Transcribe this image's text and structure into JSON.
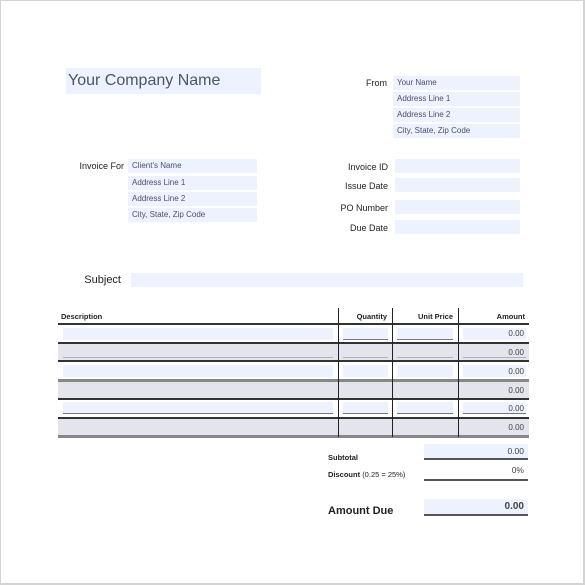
{
  "header": {
    "company_name": "Your Company Name",
    "from_label": "From",
    "from": [
      "Your Name",
      "Address Line 1",
      "Address Line 2",
      "City, State, Zip Code"
    ]
  },
  "invoice_for": {
    "label": "Invoice For",
    "lines": [
      "Client's Name",
      "Address Line 1",
      "Address Line 2",
      "City, State, Zip Code"
    ]
  },
  "meta": {
    "fields": [
      {
        "label": "Invoice ID",
        "value": ""
      },
      {
        "label": "Issue Date",
        "value": ""
      },
      {
        "label": "PO Number",
        "value": ""
      },
      {
        "label": "Due Date",
        "value": ""
      }
    ]
  },
  "subject": {
    "label": "Subject",
    "value": ""
  },
  "table": {
    "headers": {
      "description": "Description",
      "quantity": "Quantity",
      "unit_price": "Unit Price",
      "amount": "Amount"
    },
    "rows": [
      {
        "description": "",
        "quantity": "",
        "unit_price": "",
        "amount": "0.00"
      },
      {
        "description": "",
        "quantity": "",
        "unit_price": "",
        "amount": "0.00"
      },
      {
        "description": "",
        "quantity": "",
        "unit_price": "",
        "amount": "0.00"
      },
      {
        "description": "",
        "quantity": "",
        "unit_price": "",
        "amount": "0.00"
      },
      {
        "description": "",
        "quantity": "",
        "unit_price": "",
        "amount": "0.00"
      },
      {
        "description": "",
        "quantity": "",
        "unit_price": "",
        "amount": "0.00"
      }
    ]
  },
  "totals": {
    "subtotal_label": "Subtotal",
    "subtotal_value": "0.00",
    "discount_label": "Discount",
    "discount_hint": "(0.25 = 25%)",
    "discount_value": "0%",
    "amount_due_label": "Amount Due",
    "amount_due_value": "0.00"
  }
}
